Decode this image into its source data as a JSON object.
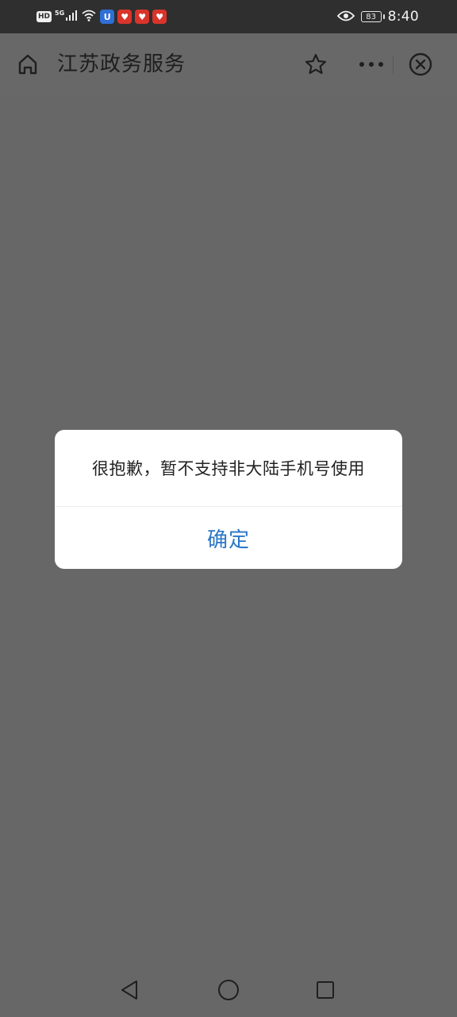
{
  "status_bar": {
    "hd_label": "HD",
    "network_label": "5G",
    "battery_level": "83",
    "time": "8:40",
    "app_badges": [
      {
        "name": "shield-app-icon",
        "glyph": "U",
        "color": "#2f6fd6"
      },
      {
        "name": "red-app-icon-1",
        "glyph": "♥",
        "color": "#d9342b"
      },
      {
        "name": "red-app-icon-2",
        "glyph": "♥",
        "color": "#d9342b"
      },
      {
        "name": "red-app-icon-3",
        "glyph": "♥",
        "color": "#d9342b"
      }
    ]
  },
  "title_bar": {
    "title": "江苏政务服务",
    "icons": [
      "home-icon",
      "star-icon",
      "more-icon",
      "close-icon"
    ]
  },
  "dialog": {
    "message": "很抱歉，暂不支持非大陆手机号使用",
    "confirm_label": "确定",
    "confirm_color": "#2a76c6"
  },
  "nav_bar": {
    "icons": [
      "back-icon",
      "home-circle-icon",
      "recent-apps-icon"
    ]
  },
  "colors": {
    "status_bar_bg": "#2f2f2f",
    "overlay_bg": "#676767",
    "dialog_bg": "#ffffff",
    "accent": "#2a76c6"
  }
}
